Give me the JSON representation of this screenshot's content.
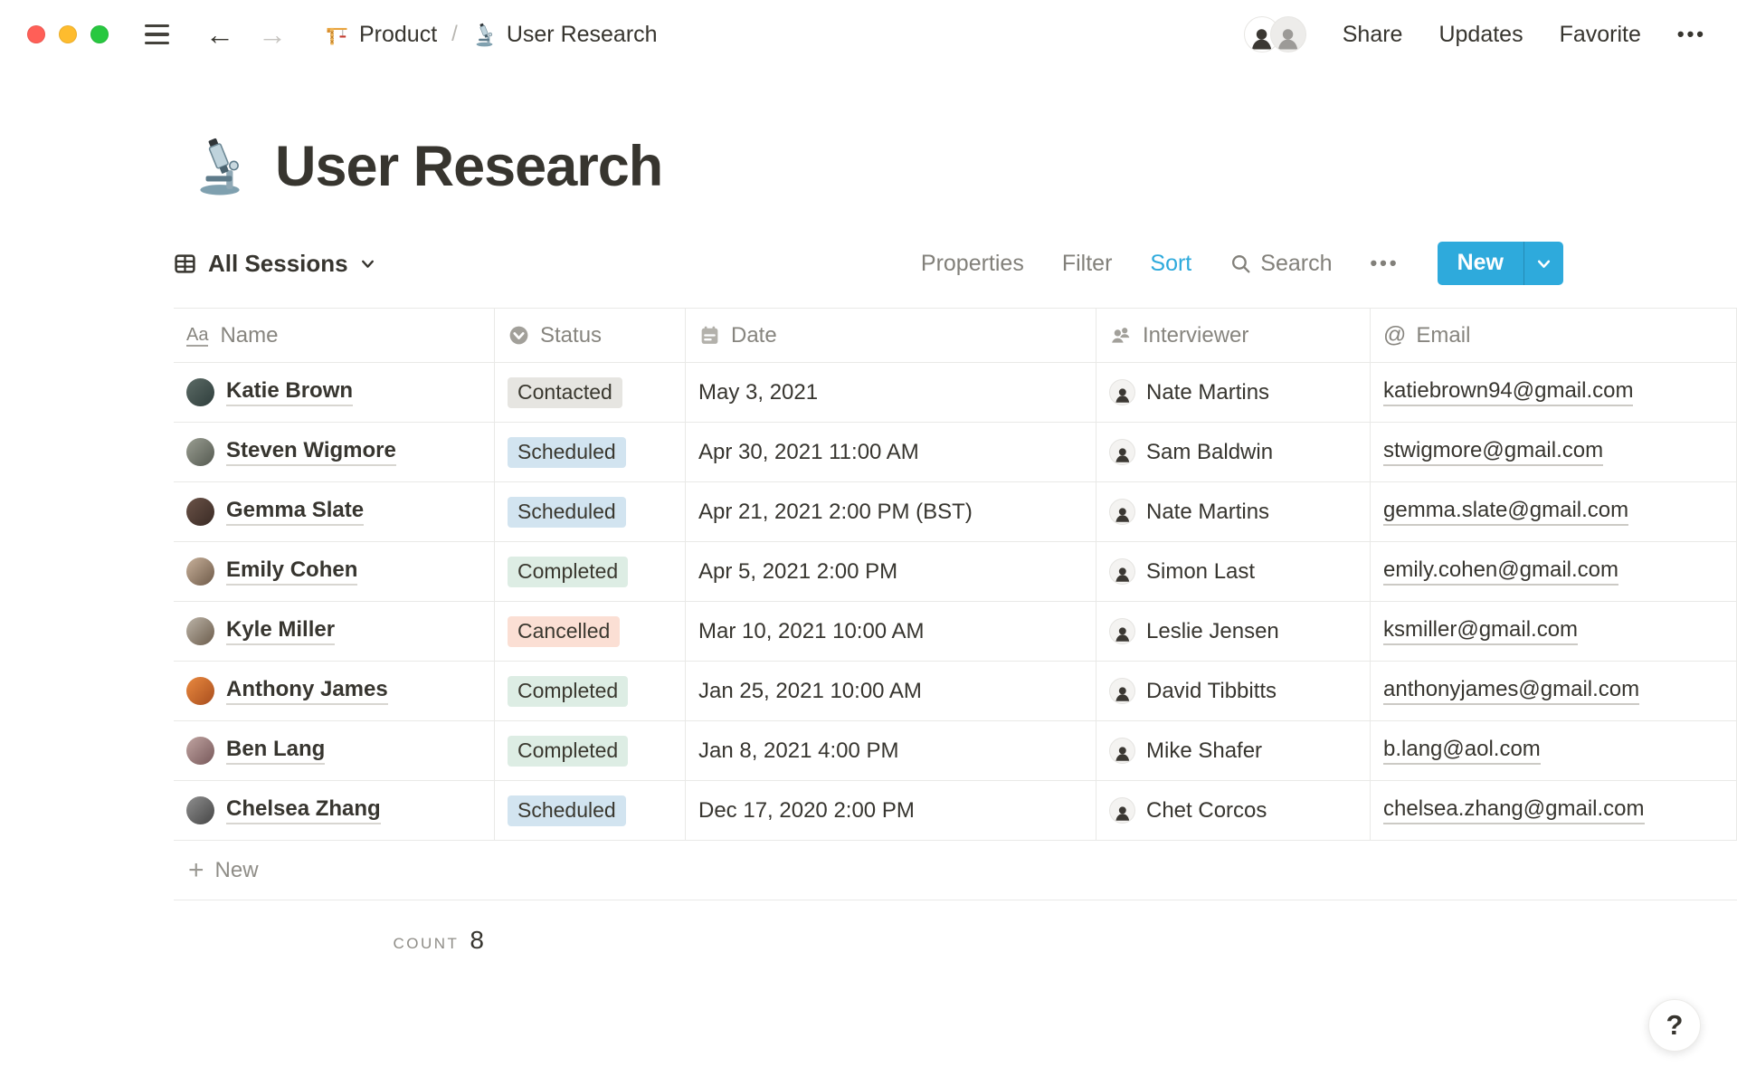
{
  "window": {
    "traffic_lights": [
      "close",
      "minimize",
      "zoom"
    ],
    "breadcrumb": {
      "separator": "/",
      "items": [
        {
          "icon": "crane-icon",
          "label": "Product"
        },
        {
          "icon": "microscope-icon",
          "label": "User Research"
        }
      ]
    },
    "actions": {
      "share": "Share",
      "updates": "Updates",
      "favorite": "Favorite",
      "more": "•••"
    }
  },
  "page": {
    "icon": "microscope-icon",
    "title": "User Research"
  },
  "view_bar": {
    "view_name": "All Sessions",
    "properties": "Properties",
    "filter": "Filter",
    "sort": "Sort",
    "search": "Search",
    "more": "•••",
    "new_label": "New",
    "accent_color": "#2EAADC",
    "sort_active_color": "#2EAADC"
  },
  "table": {
    "columns": [
      {
        "label": "Name",
        "icon": "text-icon"
      },
      {
        "label": "Status",
        "icon": "select-icon"
      },
      {
        "label": "Date",
        "icon": "calendar-icon"
      },
      {
        "label": "Interviewer",
        "icon": "person-icon"
      },
      {
        "label": "Email",
        "icon": "at-icon"
      }
    ],
    "status_colors": {
      "Contacted": "#E6E5E1",
      "Scheduled": "#D2E4F0",
      "Completed": "#DDEDE4",
      "Cancelled": "#FBDFD4"
    },
    "rows": [
      {
        "name": "Katie Brown",
        "avatar_colors": [
          "#5C6B66",
          "#2F3E3C"
        ],
        "status": "Contacted",
        "date": "May 3, 2021",
        "interviewer": "Nate Martins",
        "email": "katiebrown94@gmail.com"
      },
      {
        "name": "Steven Wigmore",
        "avatar_colors": [
          "#9A9E92",
          "#545950"
        ],
        "status": "Scheduled",
        "date": "Apr 30, 2021 11:00 AM",
        "interviewer": "Sam Baldwin",
        "email": "stwigmore@gmail.com"
      },
      {
        "name": "Gemma Slate",
        "avatar_colors": [
          "#6B5348",
          "#392A24"
        ],
        "status": "Scheduled",
        "date": "Apr 21, 2021 2:00 PM (BST)",
        "interviewer": "Nate Martins",
        "email": "gemma.slate@gmail.com"
      },
      {
        "name": "Emily Cohen",
        "avatar_colors": [
          "#C8B19B",
          "#6E5A48"
        ],
        "status": "Completed",
        "date": "Apr 5, 2021 2:00 PM",
        "interviewer": "Simon Last",
        "email": "emily.cohen@gmail.com"
      },
      {
        "name": "Kyle Miller",
        "avatar_colors": [
          "#BCB4A8",
          "#6B5C4B"
        ],
        "status": "Cancelled",
        "date": "Mar 10, 2021 10:00 AM",
        "interviewer": "Leslie Jensen",
        "email": "ksmiller@gmail.com"
      },
      {
        "name": "Anthony James",
        "avatar_colors": [
          "#EA8A3F",
          "#A84D1E"
        ],
        "status": "Completed",
        "date": "Jan 25, 2021 10:00 AM",
        "interviewer": "David Tibbitts",
        "email": "anthonyjames@gmail.com"
      },
      {
        "name": "Ben Lang",
        "avatar_colors": [
          "#C0A4A1",
          "#77585A"
        ],
        "status": "Completed",
        "date": "Jan 8, 2021 4:00 PM",
        "interviewer": "Mike Shafer",
        "email": "b.lang@aol.com"
      },
      {
        "name": "Chelsea Zhang",
        "avatar_colors": [
          "#8F8F8F",
          "#454545"
        ],
        "status": "Scheduled",
        "date": "Dec 17, 2020 2:00 PM",
        "interviewer": "Chet Corcos",
        "email": "chelsea.zhang@gmail.com"
      }
    ],
    "new_row_label": "New",
    "count_label": "COUNT",
    "count_value": "8"
  },
  "help": {
    "label": "?"
  }
}
